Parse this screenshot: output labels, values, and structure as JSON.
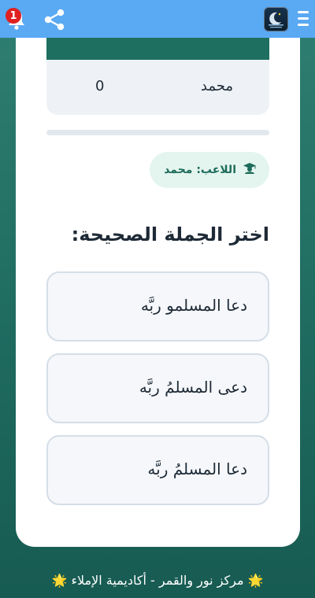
{
  "header": {
    "notification_count": "1",
    "icons": [
      "menu-icon",
      "app-logo",
      "share-icon",
      "bell-icon"
    ]
  },
  "scoreboard": {
    "rows": [
      {
        "name": "محمد",
        "score": "0"
      }
    ]
  },
  "player": {
    "label": "اللاعب: محمد",
    "icon": "graduate-icon"
  },
  "question": {
    "prompt": "اختر الجملة الصحيحة:",
    "options": [
      "دعا المسلمو ربَّه",
      "دعى المسلمُ ربَّه",
      "دعا المسلمُ ربَّه"
    ]
  },
  "footer": {
    "text": "مركز نور والقمر - أكاديمية الإملاء",
    "star": "🌟"
  },
  "colors": {
    "topbar": "#5aa9f3",
    "primary": "#1e6f5f",
    "background": "#1f6b60",
    "badge": "#e02020"
  }
}
